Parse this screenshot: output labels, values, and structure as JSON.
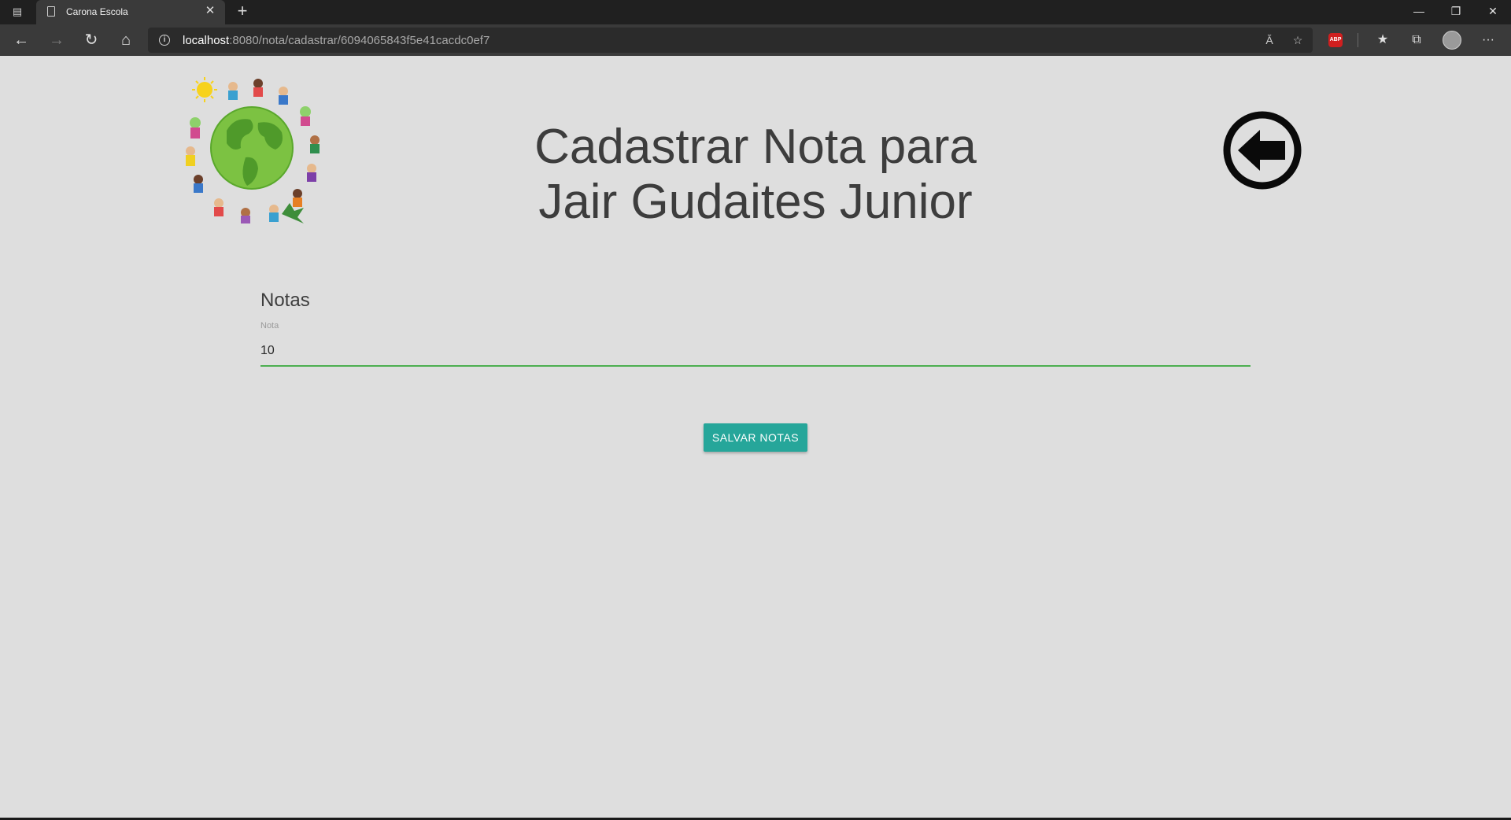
{
  "browser": {
    "tab_title": "Carona Escola",
    "tab_close_glyph": "✕",
    "new_tab_glyph": "+",
    "window_controls": {
      "minimize": "—",
      "restore": "❐",
      "close": "✕"
    },
    "nav": {
      "back": "←",
      "forward": "→",
      "reload": "↻",
      "home": "⌂"
    },
    "url_host": "localhost",
    "url_rest": ":8080/nota/cadastrar/6094065843f5e41cacdc0ef7",
    "address_icons": [
      "read-aloud-icon",
      "add-favorite-icon"
    ],
    "toolbar_icons": [
      "adblock-plus-icon",
      "favorites-icon",
      "collections-icon",
      "profile-icon",
      "more-icon"
    ],
    "abp_label": "ABP",
    "more_glyph": "···",
    "read_aloud_glyph": "Ă",
    "favorite_glyph": "☆",
    "favorites_glyph": "★",
    "collections_glyph": "⧉"
  },
  "page": {
    "title_line1": "Cadastrar Nota para",
    "title_line2": "Jair Gudaites Junior",
    "section_title": "Notas",
    "field_label": "Nota",
    "field_value": "10",
    "save_button": "SALVAR NOTAS"
  },
  "colors": {
    "page_bg": "#dedede",
    "accent_button": "#26a69a",
    "input_underline": "#4caf50",
    "title_text": "#3d3d3d"
  }
}
